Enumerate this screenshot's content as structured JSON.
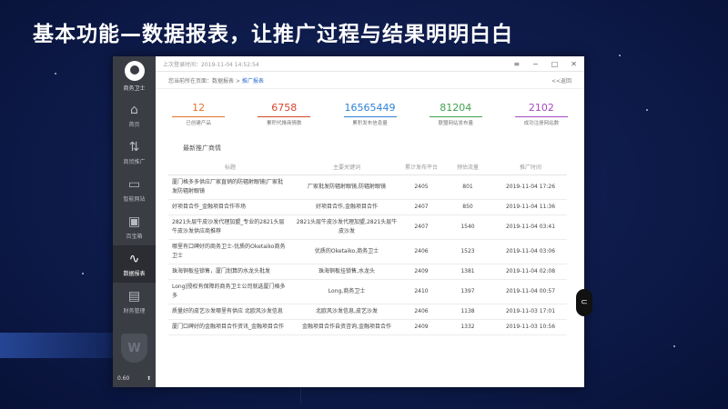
{
  "slide": {
    "title": "基本功能—数据报表，让推广过程与结果明明白白"
  },
  "sidebar": {
    "brand": "商务卫士",
    "items": [
      {
        "label": "首页",
        "icon": "home-icon",
        "glyph": "⌂"
      },
      {
        "label": "商贸推广",
        "icon": "promotion-icon",
        "glyph": "⇅"
      },
      {
        "label": "智能网站",
        "icon": "monitor-icon",
        "glyph": "▭"
      },
      {
        "label": "百宝箱",
        "icon": "toolbox-icon",
        "glyph": "▣"
      },
      {
        "label": "数据报表",
        "icon": "chart-icon",
        "glyph": "∿"
      },
      {
        "label": "财务管理",
        "icon": "finance-icon",
        "glyph": "▤"
      }
    ],
    "version": "0.60",
    "upload_glyph": "⬆"
  },
  "titlebar": {
    "last_login": "上次登录时间：2019-11-04 14:52:54",
    "menu_glyph": "≡",
    "minimize_glyph": "−",
    "maximize_glyph": "□",
    "close_glyph": "✕"
  },
  "breadcrumb": {
    "prefix": "您当前所在页面：",
    "parent": "数据报表",
    "sep": " > ",
    "current": "推广报表",
    "back": "<<返回"
  },
  "stats": [
    {
      "value": "12",
      "label": "已创建产品",
      "color": "#e8702a"
    },
    {
      "value": "6758",
      "label": "累积代推商情数",
      "color": "#d5462e"
    },
    {
      "value": "16565449",
      "label": "累积发布信息量",
      "color": "#2f82d6"
    },
    {
      "value": "81204",
      "label": "联盟网站发布量",
      "color": "#3fa34d"
    },
    {
      "value": "2102",
      "label": "成功注册网站数",
      "color": "#a44ac2"
    }
  ],
  "section": {
    "title": "最新推广商情"
  },
  "table": {
    "headers": [
      "标题",
      "主要关键词",
      "累计发布平台",
      "预估流量",
      "推广时间"
    ],
    "rows": [
      [
        "厦门格多多供应厂家直销的防辐射眼镜|厂家批发防辐射眼镜",
        "厂家批发防辐射眼镜,防辐射眼镜",
        "2405",
        "801",
        "2019-11-04 17:26"
      ],
      [
        "好项目合作_金融项目合作市场",
        "好项目合作,金融项目合作",
        "2407",
        "850",
        "2019-11-04 11:36"
      ],
      [
        "2821头层牛皮沙发代理加盟_专业的2821头层牛皮沙发供应商推荐",
        "2821头层牛皮沙发代理加盟,2821头层牛皮沙发",
        "2407",
        "1540",
        "2019-11-04 03:41"
      ],
      [
        "哪里有口碑好的商务卫士-优质的Oketaiko商务卫士",
        "优质的Oketaiko,商务卫士",
        "2406",
        "1523",
        "2019-11-04 03:06"
      ],
      [
        "珠海铜板挂锁售，厦门划算的水龙头批发",
        "珠海铜板挂锁售,水龙头",
        "2409",
        "1381",
        "2019-11-04 02:08"
      ],
      [
        "Long|授权有保障的商务卫士公司就选厦门格多多",
        "Long,商务卫士",
        "2410",
        "1397",
        "2019-11-04 00:57"
      ],
      [
        "质量好的皮艺沙发哪里有供应 北欧风沙发信息",
        "北欧风沙发信息,皮艺沙发",
        "2406",
        "1138",
        "2019-11-03 17:01"
      ],
      [
        "厦门口碑好的金融项目合作资讯_金融项目合作",
        "金融项目合作自资咨询,金融项目合作",
        "2409",
        "1332",
        "2019-11-03 10:56"
      ]
    ]
  },
  "side_button": {
    "glyph": "⊂"
  }
}
